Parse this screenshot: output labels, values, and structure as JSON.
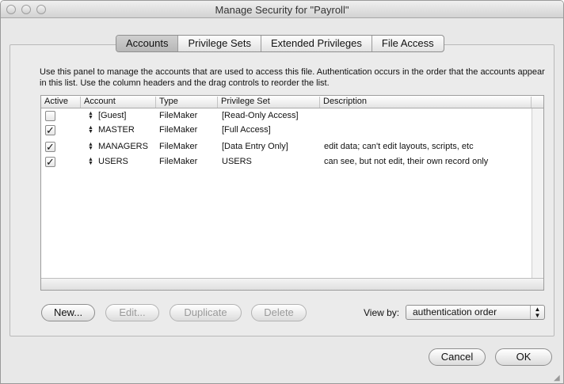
{
  "window": {
    "title": "Manage Security for \"Payroll\""
  },
  "tabs": [
    {
      "label": "Accounts",
      "selected": true
    },
    {
      "label": "Privilege Sets",
      "selected": false
    },
    {
      "label": "Extended Privileges",
      "selected": false
    },
    {
      "label": "File Access",
      "selected": false
    }
  ],
  "description": "Use this panel to manage the accounts that are used to access this file.  Authentication occurs in the order that the accounts appear in this list.  Use the column headers and the drag controls to reorder the list.",
  "table": {
    "columns": [
      "Active",
      "Account",
      "Type",
      "Privilege Set",
      "Description"
    ],
    "rows": [
      {
        "active": false,
        "check": "",
        "account": "[Guest]",
        "type": "FileMaker",
        "privilege_set": "[Read-Only Access]",
        "description": ""
      },
      {
        "active": true,
        "check": "✓",
        "account": "MASTER",
        "type": "FileMaker",
        "privilege_set": "[Full Access]",
        "description": ""
      },
      {
        "active": true,
        "check": "✓",
        "account": "MANAGERS",
        "type": "FileMaker",
        "privilege_set": "[Data Entry Only]",
        "description": "edit data; can't edit layouts, scripts, etc"
      },
      {
        "active": true,
        "check": "✓",
        "account": "USERS",
        "type": "FileMaker",
        "privilege_set": "USERS",
        "description": "can see, but not edit, their own record only"
      }
    ]
  },
  "buttons": {
    "new": "New...",
    "edit": "Edit...",
    "duplicate": "Duplicate",
    "delete": "Delete",
    "cancel": "Cancel",
    "ok": "OK"
  },
  "view_by": {
    "label": "View by:",
    "value": "authentication order"
  }
}
